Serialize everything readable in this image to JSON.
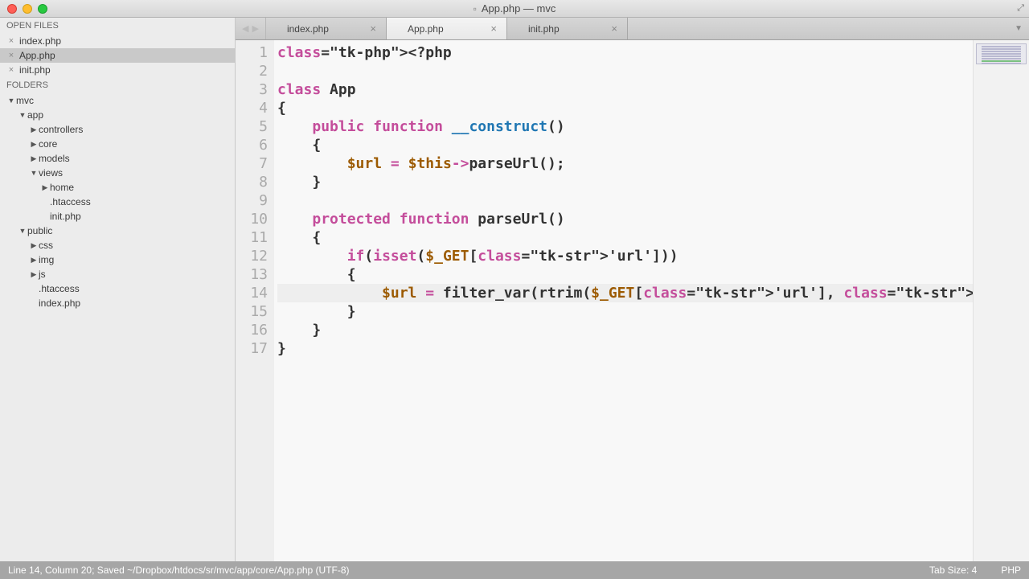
{
  "window": {
    "title": "App.php — mvc"
  },
  "sidebar": {
    "open_files_header": "OPEN FILES",
    "folders_header": "FOLDERS",
    "open_files": [
      {
        "name": "index.php",
        "active": false
      },
      {
        "name": "App.php",
        "active": true
      },
      {
        "name": "init.php",
        "active": false
      }
    ],
    "tree": [
      {
        "label": "mvc",
        "indent": 0,
        "open": true
      },
      {
        "label": "app",
        "indent": 1,
        "open": true
      },
      {
        "label": "controllers",
        "indent": 2,
        "open": false
      },
      {
        "label": "core",
        "indent": 2,
        "open": false
      },
      {
        "label": "models",
        "indent": 2,
        "open": false
      },
      {
        "label": "views",
        "indent": 2,
        "open": true
      },
      {
        "label": "home",
        "indent": 3,
        "open": false
      },
      {
        "label": ".htaccess",
        "indent": 3,
        "file": true
      },
      {
        "label": "init.php",
        "indent": 3,
        "file": true
      },
      {
        "label": "public",
        "indent": 1,
        "open": true
      },
      {
        "label": "css",
        "indent": 2,
        "open": false
      },
      {
        "label": "img",
        "indent": 2,
        "open": false
      },
      {
        "label": "js",
        "indent": 2,
        "open": false
      },
      {
        "label": ".htaccess",
        "indent": 2,
        "file": true
      },
      {
        "label": "index.php",
        "indent": 2,
        "file": true
      }
    ]
  },
  "tabs": [
    {
      "label": "index.php",
      "active": false
    },
    {
      "label": "App.php",
      "active": true
    },
    {
      "label": "init.php",
      "active": false
    }
  ],
  "code_lines": [
    "<?php",
    "",
    "class App",
    "{",
    "    public function __construct()",
    "    {",
    "        $url = $this->parseUrl();",
    "    }",
    "",
    "    protected function parseUrl()",
    "    {",
    "        if(isset($_GET['url']))",
    "        {",
    "            $url = filter_var(rtrim($_GET['url'], '/'), FILTER_SANITIZE_URL",
    "        }",
    "    }",
    "}"
  ],
  "highlight_line": 14,
  "statusbar": {
    "left": "Line 14, Column 20; Saved ~/Dropbox/htdocs/sr/mvc/app/core/App.php (UTF-8)",
    "tab_size": "Tab Size: 4",
    "lang": "PHP"
  }
}
